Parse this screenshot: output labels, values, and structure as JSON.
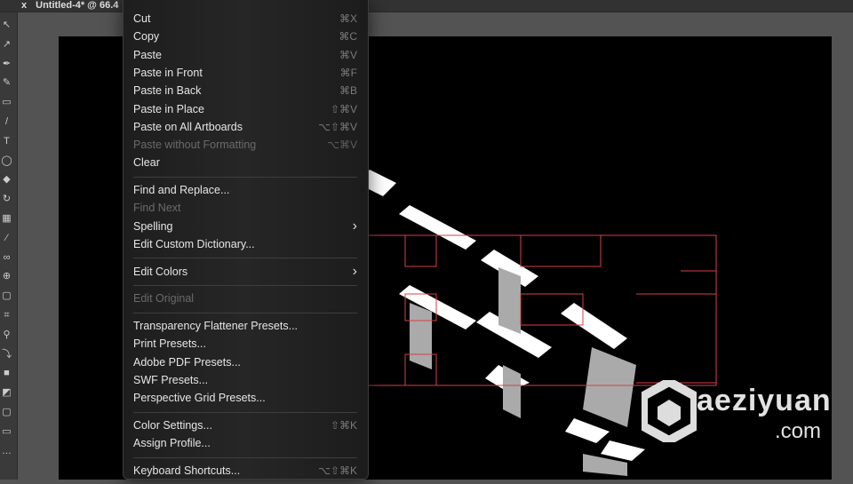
{
  "document_tab": {
    "close_label": "x",
    "title": "Untitled-4* @ 66.4"
  },
  "toolbar": {
    "tools": [
      "selection-tool",
      "direct-selection-tool",
      "pen-tool",
      "curvature-tool",
      "rectangle-tool",
      "paintbrush-tool",
      "type-tool",
      "ellipse-tool",
      "eraser-tool",
      "rotate-tool",
      "gradient-tool",
      "eyedropper-tool",
      "blend-tool",
      "shape-builder-tool",
      "artboard-tool",
      "slice-tool",
      "zoom-tool",
      "swap-colors",
      "fill-stroke",
      "color-modes",
      "drawing-modes",
      "screen-mode",
      "more-tools"
    ]
  },
  "menu": {
    "items": [
      {
        "label": "Cut",
        "shortcut": "⌘X",
        "enabled": true
      },
      {
        "label": "Copy",
        "shortcut": "⌘C",
        "enabled": true
      },
      {
        "label": "Paste",
        "shortcut": "⌘V",
        "enabled": true
      },
      {
        "label": "Paste in Front",
        "shortcut": "⌘F",
        "enabled": true
      },
      {
        "label": "Paste in Back",
        "shortcut": "⌘B",
        "enabled": true
      },
      {
        "label": "Paste in Place",
        "shortcut": "⇧⌘V",
        "enabled": true
      },
      {
        "label": "Paste on All Artboards",
        "shortcut": "⌥⇧⌘V",
        "enabled": true
      },
      {
        "label": "Paste without Formatting",
        "shortcut": "⌥⌘V",
        "enabled": false
      },
      {
        "label": "Clear",
        "shortcut": "",
        "enabled": true
      },
      {
        "separator": true
      },
      {
        "label": "Find and Replace...",
        "shortcut": "",
        "enabled": true
      },
      {
        "label": "Find Next",
        "shortcut": "",
        "enabled": false
      },
      {
        "label": "Spelling",
        "shortcut": "›",
        "enabled": true,
        "submenu": true
      },
      {
        "label": "Edit Custom Dictionary...",
        "shortcut": "",
        "enabled": true
      },
      {
        "separator": true
      },
      {
        "label": "Edit Colors",
        "shortcut": "›",
        "enabled": true,
        "submenu": true
      },
      {
        "separator": true
      },
      {
        "label": "Edit Original",
        "shortcut": "",
        "enabled": false
      },
      {
        "separator": true
      },
      {
        "label": "Transparency Flattener Presets...",
        "shortcut": "",
        "enabled": true
      },
      {
        "label": "Print Presets...",
        "shortcut": "",
        "enabled": true
      },
      {
        "label": "Adobe PDF Presets...",
        "shortcut": "",
        "enabled": true
      },
      {
        "label": "SWF Presets...",
        "shortcut": "",
        "enabled": true
      },
      {
        "label": "Perspective Grid Presets...",
        "shortcut": "",
        "enabled": true
      },
      {
        "separator": true
      },
      {
        "label": "Color Settings...",
        "shortcut": "⇧⌘K",
        "enabled": true
      },
      {
        "label": "Assign Profile...",
        "shortcut": "",
        "enabled": true
      },
      {
        "separator": true
      },
      {
        "label": "Keyboard Shortcuts...",
        "shortcut": "⌥⇧⌘K",
        "enabled": true
      }
    ]
  },
  "watermark": {
    "text": "aeziyuan",
    "domain": ".com"
  },
  "colors": {
    "selection": "#d6404a",
    "artwork": "#ffffff",
    "artboard": "#000000"
  }
}
